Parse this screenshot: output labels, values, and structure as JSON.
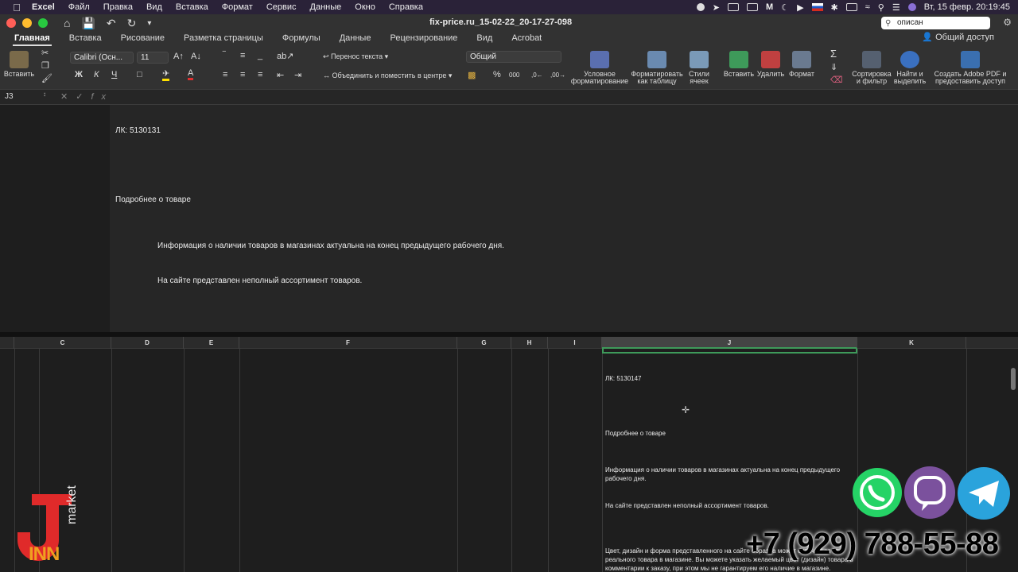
{
  "menubar": {
    "app": "Excel",
    "items": [
      "Файл",
      "Правка",
      "Вид",
      "Вставка",
      "Формат",
      "Сервис",
      "Данные",
      "Окно",
      "Справка"
    ],
    "clock": "Вт, 15 февр.  20:19:45"
  },
  "titlebar": {
    "title": "fix-price.ru_15-02-22_20-17-27-098",
    "search_value": "описан"
  },
  "tabs": {
    "items": [
      "Главная",
      "Вставка",
      "Рисование",
      "Разметка страницы",
      "Формулы",
      "Данные",
      "Рецензирование",
      "Вид",
      "Acrobat"
    ],
    "active_index": 0,
    "share": "Общий доступ"
  },
  "ribbon": {
    "paste": "Вставить",
    "font_name": "Calibri (Осн...",
    "font_size": "11",
    "bold": "Ж",
    "italic": "К",
    "underline": "Ч",
    "wrap_text": "Перенос текста",
    "merge_center": "Объединить и поместить в центре",
    "number_format": "Общий",
    "conditional": "Условное форматирование",
    "format_table": "Форматировать как таблицу",
    "cell_styles": "Стили ячеек",
    "insert": "Вставить",
    "delete": "Удалить",
    "format": "Формат",
    "sort_filter": "Сортировка и фильтр",
    "find_select": "Найти и выделить",
    "adobe": "Создать Adobe PDF и предоставить доступ"
  },
  "formula_bar": {
    "name_box": "J3",
    "fx": "fx"
  },
  "expanded_formula": {
    "lk": "ЛК: 5130131",
    "more": "Подробнее о товаре",
    "info": "Информация о наличии товаров в магазинах актуальна на конец предыдущего рабочего дня.",
    "assortment": "На сайте представлен неполный ассортимент товаров."
  },
  "columns": [
    "C",
    "D",
    "E",
    "F",
    "G",
    "H",
    "I",
    "J",
    "K"
  ],
  "selected_column": "J",
  "cell_j": {
    "lk": "ЛК: 5130147",
    "more": "Подробнее о товаре",
    "info": "Информация о наличии товаров в магазинах актуальна на конец предыдущего рабочего дня.",
    "assortment": "На сайте представлен неполный ассортимент товаров.",
    "color": "Цвет, дизайн и форма представленного на сайте образца может отличаться от реального товара в магазине. Вы можете указать желаемый цвет (дизайн) товара в комментарии к заказу, при этом мы не гарантируем его наличие в магазине."
  },
  "overlay": {
    "logo_text": "market",
    "logo_letters": "INN",
    "phone": "+7 (929) 788-55-88"
  },
  "colors": {
    "selection": "#3e9a5a",
    "whatsapp": "#25d366",
    "viber": "#7b519d",
    "telegram": "#2aa3dc"
  }
}
